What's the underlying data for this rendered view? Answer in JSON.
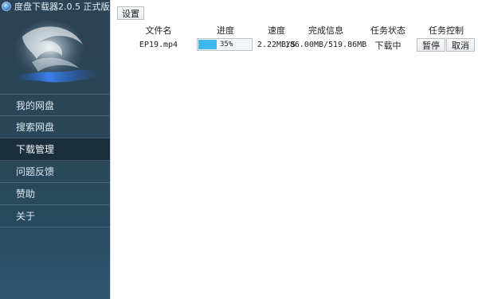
{
  "window": {
    "title": "度盘下载器2.0.5 正式版"
  },
  "sidebar": {
    "items": [
      {
        "label": "我的网盘",
        "active": false
      },
      {
        "label": "搜索网盘",
        "active": false
      },
      {
        "label": "下载管理",
        "active": true
      },
      {
        "label": "问题反馈",
        "active": false
      },
      {
        "label": "赞助",
        "active": false
      },
      {
        "label": "关于",
        "active": false
      }
    ]
  },
  "toolbar": {
    "settings_label": "设置"
  },
  "table": {
    "columns": [
      "文件名",
      "进度",
      "速度",
      "完成信息",
      "任务状态",
      "任务控制"
    ],
    "rows": [
      {
        "filename": "EP19.mp4",
        "progress_text": "35%",
        "progress_value": 0.35,
        "speed": "2.22MB/S",
        "completion": "186.00MB/519.86MB",
        "status": "下载中",
        "pause_label": "暂停",
        "cancel_label": "取消"
      }
    ]
  },
  "colors": {
    "sidebar_bg": "#2a4657",
    "sidebar_active": "#1a2e3c",
    "progress_fill": "#41b6ee"
  }
}
